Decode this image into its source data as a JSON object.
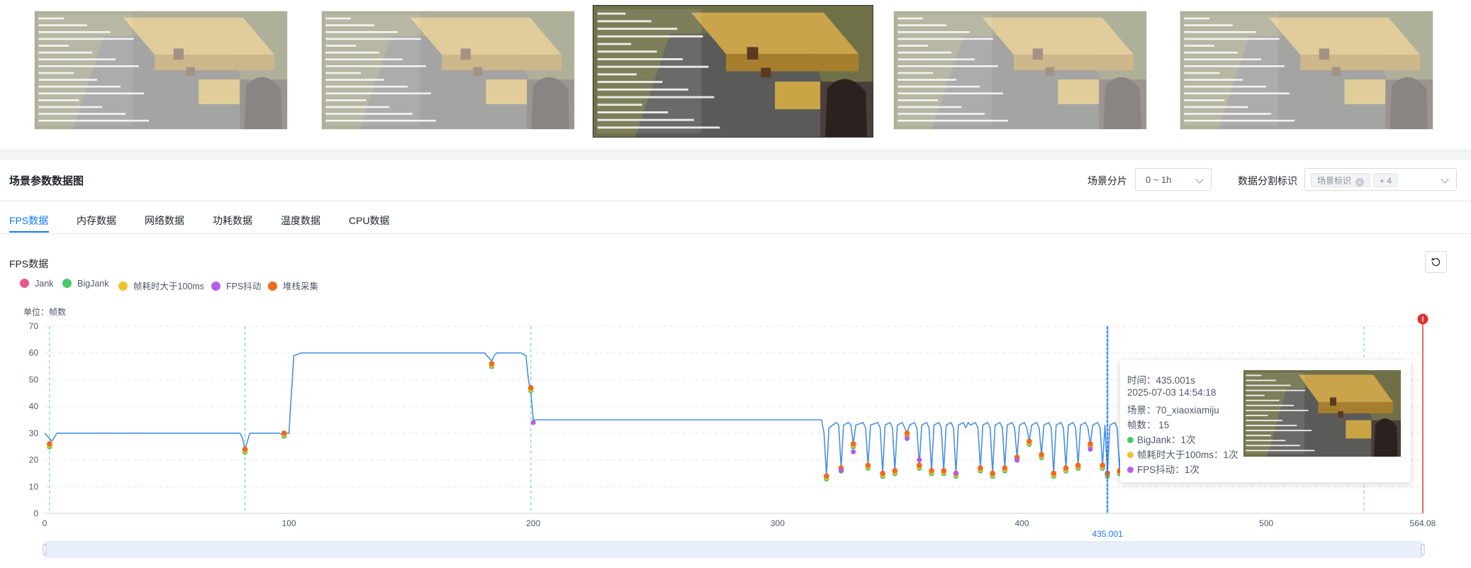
{
  "thumbnails": [
    {
      "state": "dim"
    },
    {
      "state": "dim"
    },
    {
      "state": "active"
    },
    {
      "state": "dim"
    },
    {
      "state": "dim"
    }
  ],
  "header": {
    "title": "场景参数数据图",
    "scene_split_label": "场景分片",
    "scene_split_value": "0 ~ 1h",
    "data_split_label": "数据分割标识",
    "data_split_tag": "场景标识",
    "data_split_more": "+ 4"
  },
  "tabs": [
    {
      "label": "FPS数据",
      "active": true
    },
    {
      "label": "内存数据",
      "active": false
    },
    {
      "label": "网络数据",
      "active": false
    },
    {
      "label": "功耗数据",
      "active": false
    },
    {
      "label": "温度数据",
      "active": false
    },
    {
      "label": "CPU数据",
      "active": false
    }
  ],
  "chart_title": "FPS数据",
  "unit_label": "单位：帧数",
  "legend": [
    {
      "name": "Jank",
      "color": "#e8588f"
    },
    {
      "name": "BigJank",
      "color": "#4cc76a"
    },
    {
      "name": "帧耗时大于100ms",
      "color": "#f2c12e"
    },
    {
      "name": "FPS抖动",
      "color": "#b65de6"
    },
    {
      "name": "堆栈采集",
      "color": "#f06a1e"
    }
  ],
  "tooltip": {
    "time": "时间：435.001s",
    "datetime": "2025-07-03 14:54:18",
    "scene": "场景：70_xiaoxiamiju",
    "fps": "帧数： 15",
    "bigjank": "BigJank：1次",
    "over100": "帧耗时大于100ms：1次",
    "jitter": "FPS抖动：1次"
  },
  "chart_data": {
    "type": "line",
    "xlim": [
      0,
      564.08
    ],
    "ylim": [
      0,
      70
    ],
    "x_ticks": [
      "0",
      "100",
      "200",
      "300",
      "400",
      "500",
      "564.08"
    ],
    "y_ticks": [
      "0",
      "10",
      "20",
      "30",
      "40",
      "50",
      "60",
      "70"
    ],
    "cursor_x": 435.001,
    "cursor_label": "435.001",
    "grid": true,
    "legend_position": "top-left",
    "scene_markers_x": [
      2,
      82,
      199,
      540
    ],
    "alert_marker_x": 564.08,
    "series": [
      {
        "points": [
          [
            0,
            30
          ],
          [
            1,
            29
          ],
          [
            3,
            27
          ],
          [
            5,
            30
          ],
          [
            10,
            30
          ],
          [
            20,
            30
          ],
          [
            30,
            30
          ],
          [
            40,
            30
          ],
          [
            50,
            30
          ],
          [
            60,
            30
          ],
          [
            70,
            30
          ],
          [
            80,
            30
          ],
          [
            81,
            28
          ],
          [
            82,
            24
          ],
          [
            83,
            27
          ],
          [
            84,
            30
          ],
          [
            90,
            30
          ],
          [
            96,
            30
          ],
          [
            98,
            29
          ],
          [
            99,
            30
          ],
          [
            100,
            30
          ],
          [
            101,
            45
          ],
          [
            102,
            59
          ],
          [
            105,
            60
          ],
          [
            120,
            60
          ],
          [
            140,
            60
          ],
          [
            160,
            60
          ],
          [
            175,
            60
          ],
          [
            180,
            60
          ],
          [
            183,
            57
          ],
          [
            184,
            59
          ],
          [
            185,
            60
          ],
          [
            190,
            60
          ],
          [
            195,
            60
          ],
          [
            197,
            59
          ],
          [
            198,
            50
          ],
          [
            199,
            45
          ],
          [
            200,
            35
          ],
          [
            205,
            35
          ],
          [
            230,
            35
          ],
          [
            260,
            35
          ],
          [
            290,
            35
          ],
          [
            318,
            35
          ],
          [
            319,
            30
          ],
          [
            320,
            14
          ],
          [
            321,
            32
          ],
          [
            324,
            34
          ],
          [
            325,
            33
          ],
          [
            326,
            17
          ],
          [
            327,
            33
          ],
          [
            329,
            34
          ],
          [
            330,
            33
          ],
          [
            331,
            26
          ],
          [
            332,
            33
          ],
          [
            335,
            34
          ],
          [
            336,
            32
          ],
          [
            337,
            18
          ],
          [
            338,
            33
          ],
          [
            341,
            34
          ],
          [
            342,
            32
          ],
          [
            343,
            15
          ],
          [
            344,
            33
          ],
          [
            346,
            34
          ],
          [
            347,
            32
          ],
          [
            348,
            16
          ],
          [
            349,
            33
          ],
          [
            351,
            34
          ],
          [
            352,
            32
          ],
          [
            353,
            30
          ],
          [
            354,
            33
          ],
          [
            356,
            34
          ],
          [
            357,
            32
          ],
          [
            358,
            18
          ],
          [
            359,
            33
          ],
          [
            361,
            34
          ],
          [
            362,
            32
          ],
          [
            363,
            16
          ],
          [
            364,
            33
          ],
          [
            366,
            34
          ],
          [
            367,
            32
          ],
          [
            368,
            16
          ],
          [
            369,
            33
          ],
          [
            371,
            34
          ],
          [
            372,
            32
          ],
          [
            373,
            15
          ],
          [
            374,
            33
          ],
          [
            376,
            34
          ],
          [
            377,
            32
          ],
          [
            378,
            34
          ],
          [
            379,
            33
          ],
          [
            381,
            34
          ],
          [
            382,
            32
          ],
          [
            383,
            17
          ],
          [
            384,
            33
          ],
          [
            386,
            34
          ],
          [
            387,
            32
          ],
          [
            388,
            15
          ],
          [
            389,
            33
          ],
          [
            391,
            34
          ],
          [
            392,
            32
          ],
          [
            393,
            17
          ],
          [
            394,
            33
          ],
          [
            396,
            34
          ],
          [
            397,
            32
          ],
          [
            398,
            21
          ],
          [
            399,
            33
          ],
          [
            401,
            34
          ],
          [
            402,
            32
          ],
          [
            403,
            27
          ],
          [
            404,
            33
          ],
          [
            406,
            34
          ],
          [
            407,
            32
          ],
          [
            408,
            22
          ],
          [
            409,
            33
          ],
          [
            411,
            34
          ],
          [
            412,
            32
          ],
          [
            413,
            15
          ],
          [
            414,
            33
          ],
          [
            416,
            34
          ],
          [
            417,
            32
          ],
          [
            418,
            17
          ],
          [
            419,
            33
          ],
          [
            421,
            34
          ],
          [
            422,
            32
          ],
          [
            423,
            18
          ],
          [
            424,
            33
          ],
          [
            426,
            34
          ],
          [
            427,
            32
          ],
          [
            428,
            26
          ],
          [
            429,
            33
          ],
          [
            431,
            34
          ],
          [
            432,
            32
          ],
          [
            433,
            18
          ],
          [
            434,
            33
          ],
          [
            435,
            15
          ],
          [
            436,
            33
          ],
          [
            438,
            34
          ],
          [
            439,
            32
          ],
          [
            440,
            16
          ],
          [
            441,
            33
          ],
          [
            443,
            34
          ]
        ]
      }
    ],
    "event_markers": [
      {
        "x": 2,
        "y": 26
      },
      {
        "x": 82,
        "y": 24
      },
      {
        "x": 98,
        "y": 30
      },
      {
        "x": 183,
        "y": 56
      },
      {
        "x": 199,
        "y": 47
      },
      {
        "x": 320,
        "y": 14
      },
      {
        "x": 326,
        "y": 17
      },
      {
        "x": 331,
        "y": 26
      },
      {
        "x": 337,
        "y": 18
      },
      {
        "x": 343,
        "y": 15
      },
      {
        "x": 348,
        "y": 16
      },
      {
        "x": 353,
        "y": 30
      },
      {
        "x": 358,
        "y": 18
      },
      {
        "x": 363,
        "y": 16
      },
      {
        "x": 368,
        "y": 16
      },
      {
        "x": 373,
        "y": 15
      },
      {
        "x": 383,
        "y": 17
      },
      {
        "x": 388,
        "y": 15
      },
      {
        "x": 393,
        "y": 17
      },
      {
        "x": 398,
        "y": 21
      },
      {
        "x": 403,
        "y": 27
      },
      {
        "x": 408,
        "y": 22
      },
      {
        "x": 413,
        "y": 15
      },
      {
        "x": 418,
        "y": 17
      },
      {
        "x": 423,
        "y": 18
      },
      {
        "x": 428,
        "y": 26
      },
      {
        "x": 433,
        "y": 18
      },
      {
        "x": 435,
        "y": 15
      },
      {
        "x": 440,
        "y": 16
      }
    ],
    "jitter_markers": [
      {
        "x": 200,
        "y": 34
      },
      {
        "x": 326,
        "y": 16
      },
      {
        "x": 331,
        "y": 23
      },
      {
        "x": 353,
        "y": 28
      },
      {
        "x": 358,
        "y": 20
      },
      {
        "x": 373,
        "y": 15
      },
      {
        "x": 398,
        "y": 20
      },
      {
        "x": 428,
        "y": 24
      }
    ]
  }
}
